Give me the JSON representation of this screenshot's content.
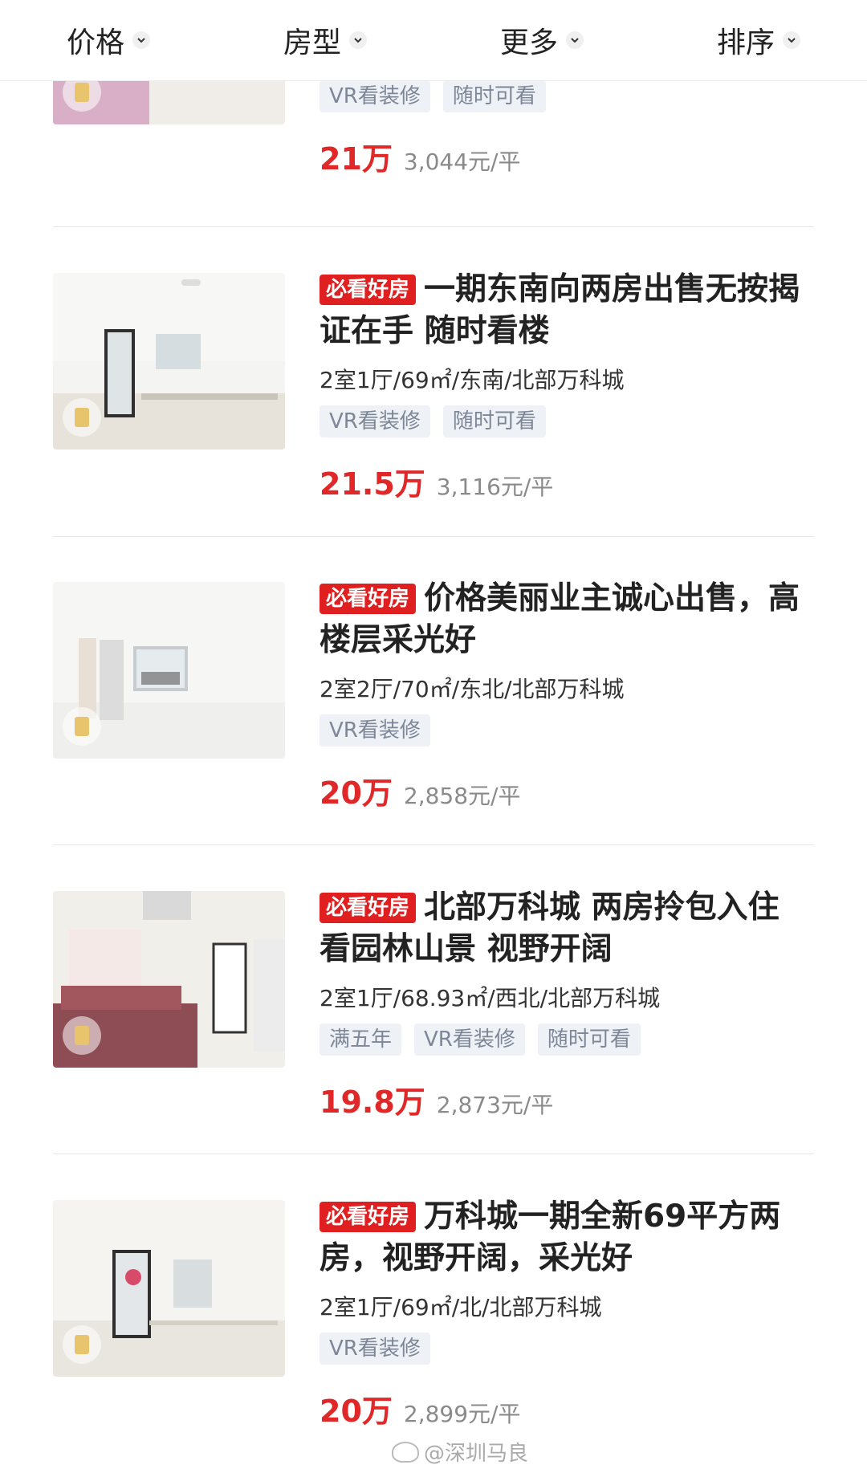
{
  "filters": [
    "价格",
    "房型",
    "更多",
    "排序"
  ],
  "listings": [
    {
      "must_see": "",
      "title": "",
      "specs": "",
      "tags": [
        "VR看装修",
        "随时可看"
      ],
      "price": "21万",
      "unit_price": "3,044元/平"
    },
    {
      "must_see": "必看好房",
      "title": "一期东南向两房出售无按揭证在手  随时看楼",
      "specs": "2室1厅/69㎡/东南/北部万科城",
      "tags": [
        "VR看装修",
        "随时可看"
      ],
      "price": "21.5万",
      "unit_price": "3,116元/平"
    },
    {
      "must_see": "必看好房",
      "title": "价格美丽业主诚心出售，高楼层采光好",
      "specs": "2室2厅/70㎡/东北/北部万科城",
      "tags": [
        "VR看装修"
      ],
      "price": "20万",
      "unit_price": "2,858元/平"
    },
    {
      "must_see": "必看好房",
      "title": "北部万科城 两房拎包入住  看园林山景 视野开阔",
      "specs": "2室1厅/68.93㎡/西北/北部万科城",
      "tags": [
        "满五年",
        "VR看装修",
        "随时可看"
      ],
      "price": "19.8万",
      "unit_price": "2,873元/平"
    },
    {
      "must_see": "必看好房",
      "title": "万科城一期全新69平方两房，视野开阔，采光好",
      "specs": "2室1厅/69㎡/北/北部万科城",
      "tags": [
        "VR看装修"
      ],
      "price": "20万",
      "unit_price": "2,899元/平"
    }
  ],
  "watermark": "@深圳马良"
}
